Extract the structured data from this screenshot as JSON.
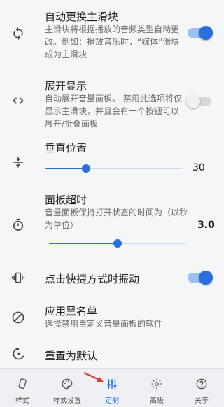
{
  "settings": {
    "auto_switch": {
      "title": "自动更换主滑块",
      "desc": "主滑块将根据播放的音频类型自动更改。例如：播放音乐时，“媒体”滑块成为主滑块",
      "enabled": true
    },
    "expand": {
      "title": "展开显示",
      "desc": "自动展开音量面板。 禁用此选项将仅显示主滑块，并且会有一个按钮可以展开/折叠面板",
      "enabled": false
    },
    "vertical_position": {
      "title": "垂直位置",
      "value": "30",
      "fraction": 0.3
    },
    "panel_timeout": {
      "title": "面板超时",
      "desc": "音量面板保持打开状态的时间为（以秒为单位）",
      "value": "3.0",
      "fraction": 0.5
    },
    "vibrate": {
      "title": "点击快捷方式时振动",
      "enabled": true
    },
    "blacklist": {
      "title": "应用黑名单",
      "desc": "选择禁用自定义音量面板的软件"
    },
    "reset": {
      "title": "重置为默认"
    }
  },
  "nav": [
    {
      "label": "样式",
      "icon": "style-icon"
    },
    {
      "label": "样式设置",
      "icon": "palette-icon"
    },
    {
      "label": "定制",
      "icon": "tune-icon",
      "active": true
    },
    {
      "label": "高级",
      "icon": "gear-icon"
    },
    {
      "label": "关于",
      "icon": "help-icon"
    }
  ],
  "colors": {
    "accent": "#2a6fe0",
    "arrow": "#e53935"
  }
}
